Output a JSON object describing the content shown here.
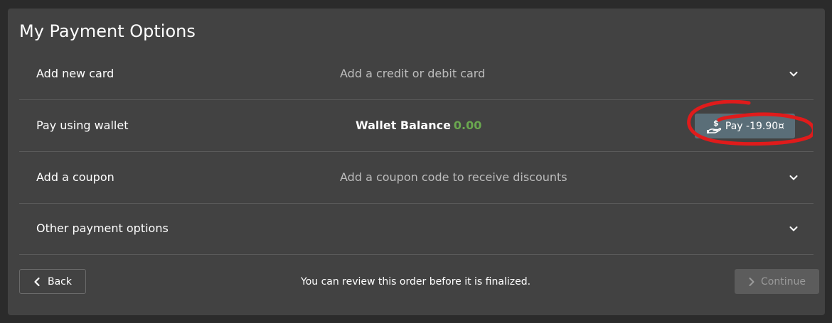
{
  "page": {
    "title": "My Payment Options"
  },
  "rows": [
    {
      "label": "Add new card",
      "description": "Add a credit or debit card",
      "icon": "chevron-down-icon"
    },
    {
      "label": "Pay using wallet",
      "wallet_label": "Wallet Balance",
      "wallet_amount": "0.00",
      "pay_button_label": "Pay -19.90¤",
      "icon": "hand-dollar-icon"
    },
    {
      "label": "Add a coupon",
      "description": "Add a coupon code to receive discounts",
      "icon": "chevron-down-icon"
    },
    {
      "label": "Other payment options",
      "icon": "chevron-down-icon"
    }
  ],
  "footer": {
    "back_label": "Back",
    "note": "You can review this order before it is finalized.",
    "continue_label": "Continue"
  },
  "colors": {
    "panel_bg": "#424242",
    "page_bg": "#2b2b2b",
    "wallet_amount": "#6aa84f",
    "pay_button": "#5a6e78",
    "annotation": "#e01b1b",
    "continue_disabled": "#5c5c5c"
  }
}
